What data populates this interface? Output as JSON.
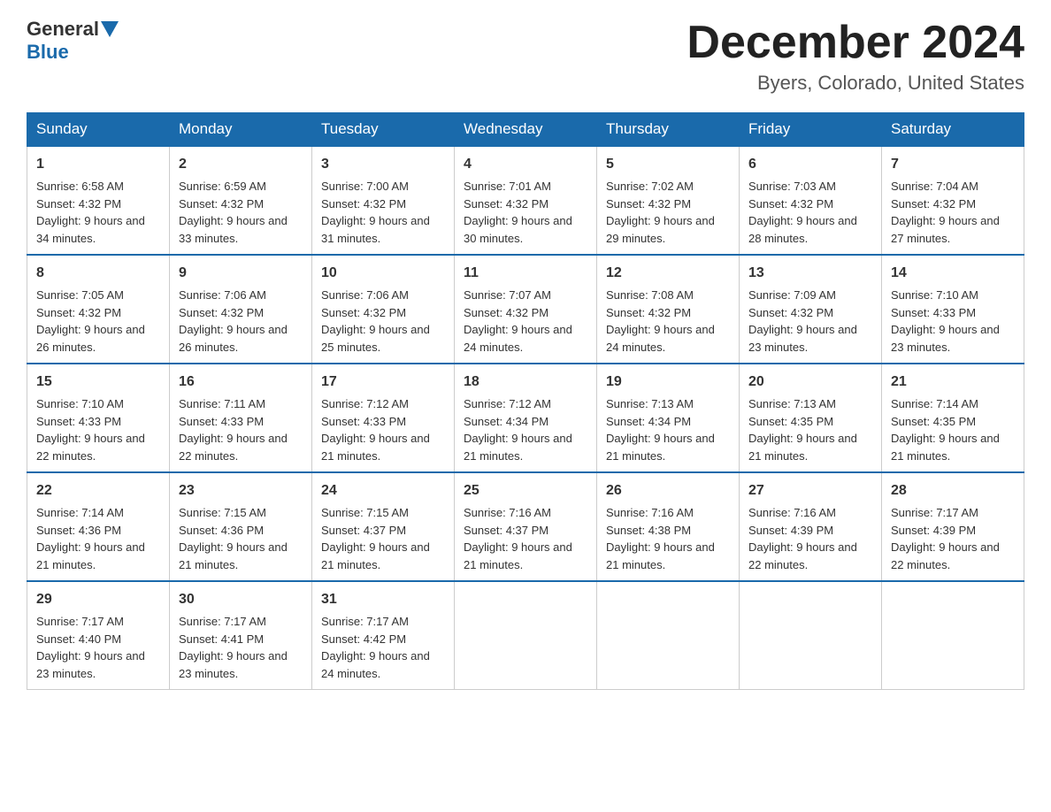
{
  "header": {
    "logo_general": "General",
    "logo_blue": "Blue",
    "month_title": "December 2024",
    "location": "Byers, Colorado, United States"
  },
  "weekdays": [
    "Sunday",
    "Monday",
    "Tuesday",
    "Wednesday",
    "Thursday",
    "Friday",
    "Saturday"
  ],
  "weeks": [
    [
      {
        "day": "1",
        "sunrise": "6:58 AM",
        "sunset": "4:32 PM",
        "daylight": "9 hours and 34 minutes."
      },
      {
        "day": "2",
        "sunrise": "6:59 AM",
        "sunset": "4:32 PM",
        "daylight": "9 hours and 33 minutes."
      },
      {
        "day": "3",
        "sunrise": "7:00 AM",
        "sunset": "4:32 PM",
        "daylight": "9 hours and 31 minutes."
      },
      {
        "day": "4",
        "sunrise": "7:01 AM",
        "sunset": "4:32 PM",
        "daylight": "9 hours and 30 minutes."
      },
      {
        "day": "5",
        "sunrise": "7:02 AM",
        "sunset": "4:32 PM",
        "daylight": "9 hours and 29 minutes."
      },
      {
        "day": "6",
        "sunrise": "7:03 AM",
        "sunset": "4:32 PM",
        "daylight": "9 hours and 28 minutes."
      },
      {
        "day": "7",
        "sunrise": "7:04 AM",
        "sunset": "4:32 PM",
        "daylight": "9 hours and 27 minutes."
      }
    ],
    [
      {
        "day": "8",
        "sunrise": "7:05 AM",
        "sunset": "4:32 PM",
        "daylight": "9 hours and 26 minutes."
      },
      {
        "day": "9",
        "sunrise": "7:06 AM",
        "sunset": "4:32 PM",
        "daylight": "9 hours and 26 minutes."
      },
      {
        "day": "10",
        "sunrise": "7:06 AM",
        "sunset": "4:32 PM",
        "daylight": "9 hours and 25 minutes."
      },
      {
        "day": "11",
        "sunrise": "7:07 AM",
        "sunset": "4:32 PM",
        "daylight": "9 hours and 24 minutes."
      },
      {
        "day": "12",
        "sunrise": "7:08 AM",
        "sunset": "4:32 PM",
        "daylight": "9 hours and 24 minutes."
      },
      {
        "day": "13",
        "sunrise": "7:09 AM",
        "sunset": "4:32 PM",
        "daylight": "9 hours and 23 minutes."
      },
      {
        "day": "14",
        "sunrise": "7:10 AM",
        "sunset": "4:33 PM",
        "daylight": "9 hours and 23 minutes."
      }
    ],
    [
      {
        "day": "15",
        "sunrise": "7:10 AM",
        "sunset": "4:33 PM",
        "daylight": "9 hours and 22 minutes."
      },
      {
        "day": "16",
        "sunrise": "7:11 AM",
        "sunset": "4:33 PM",
        "daylight": "9 hours and 22 minutes."
      },
      {
        "day": "17",
        "sunrise": "7:12 AM",
        "sunset": "4:33 PM",
        "daylight": "9 hours and 21 minutes."
      },
      {
        "day": "18",
        "sunrise": "7:12 AM",
        "sunset": "4:34 PM",
        "daylight": "9 hours and 21 minutes."
      },
      {
        "day": "19",
        "sunrise": "7:13 AM",
        "sunset": "4:34 PM",
        "daylight": "9 hours and 21 minutes."
      },
      {
        "day": "20",
        "sunrise": "7:13 AM",
        "sunset": "4:35 PM",
        "daylight": "9 hours and 21 minutes."
      },
      {
        "day": "21",
        "sunrise": "7:14 AM",
        "sunset": "4:35 PM",
        "daylight": "9 hours and 21 minutes."
      }
    ],
    [
      {
        "day": "22",
        "sunrise": "7:14 AM",
        "sunset": "4:36 PM",
        "daylight": "9 hours and 21 minutes."
      },
      {
        "day": "23",
        "sunrise": "7:15 AM",
        "sunset": "4:36 PM",
        "daylight": "9 hours and 21 minutes."
      },
      {
        "day": "24",
        "sunrise": "7:15 AM",
        "sunset": "4:37 PM",
        "daylight": "9 hours and 21 minutes."
      },
      {
        "day": "25",
        "sunrise": "7:16 AM",
        "sunset": "4:37 PM",
        "daylight": "9 hours and 21 minutes."
      },
      {
        "day": "26",
        "sunrise": "7:16 AM",
        "sunset": "4:38 PM",
        "daylight": "9 hours and 21 minutes."
      },
      {
        "day": "27",
        "sunrise": "7:16 AM",
        "sunset": "4:39 PM",
        "daylight": "9 hours and 22 minutes."
      },
      {
        "day": "28",
        "sunrise": "7:17 AM",
        "sunset": "4:39 PM",
        "daylight": "9 hours and 22 minutes."
      }
    ],
    [
      {
        "day": "29",
        "sunrise": "7:17 AM",
        "sunset": "4:40 PM",
        "daylight": "9 hours and 23 minutes."
      },
      {
        "day": "30",
        "sunrise": "7:17 AM",
        "sunset": "4:41 PM",
        "daylight": "9 hours and 23 minutes."
      },
      {
        "day": "31",
        "sunrise": "7:17 AM",
        "sunset": "4:42 PM",
        "daylight": "9 hours and 24 minutes."
      },
      null,
      null,
      null,
      null
    ]
  ]
}
